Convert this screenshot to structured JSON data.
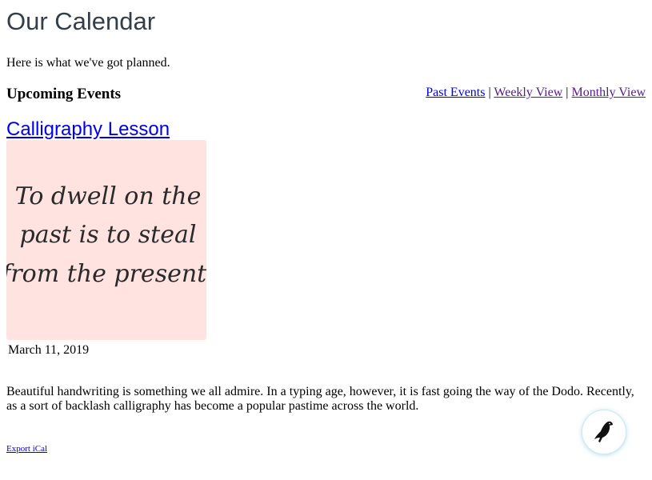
{
  "page": {
    "title": "Our Calendar",
    "intro": "Here is what we've got planned."
  },
  "section": {
    "heading": "Upcoming Events",
    "view_links": {
      "past": "Past Events",
      "separator": "|",
      "weekly": "Weekly View",
      "monthly": "Monthly View"
    }
  },
  "event": {
    "title": "Calligraphy Lesson",
    "image": {
      "lines": [
        "To dwell on the",
        "past is to steal",
        "from the present."
      ],
      "background": "#ffe3e1"
    },
    "date": "March 11, 2019",
    "description": "Beautiful handwriting is something we all admire. In a typing age, however, it is fast going the way of the Dodo. Recently, as a sort of backlash calligraphy has become a popular pastime across the world.",
    "export_label": "Export iCal"
  },
  "fab": {
    "icon": "bird-icon"
  },
  "colors": {
    "link": "#0000ee",
    "visited_link": "#551a8b",
    "title_text": "#333e48"
  }
}
